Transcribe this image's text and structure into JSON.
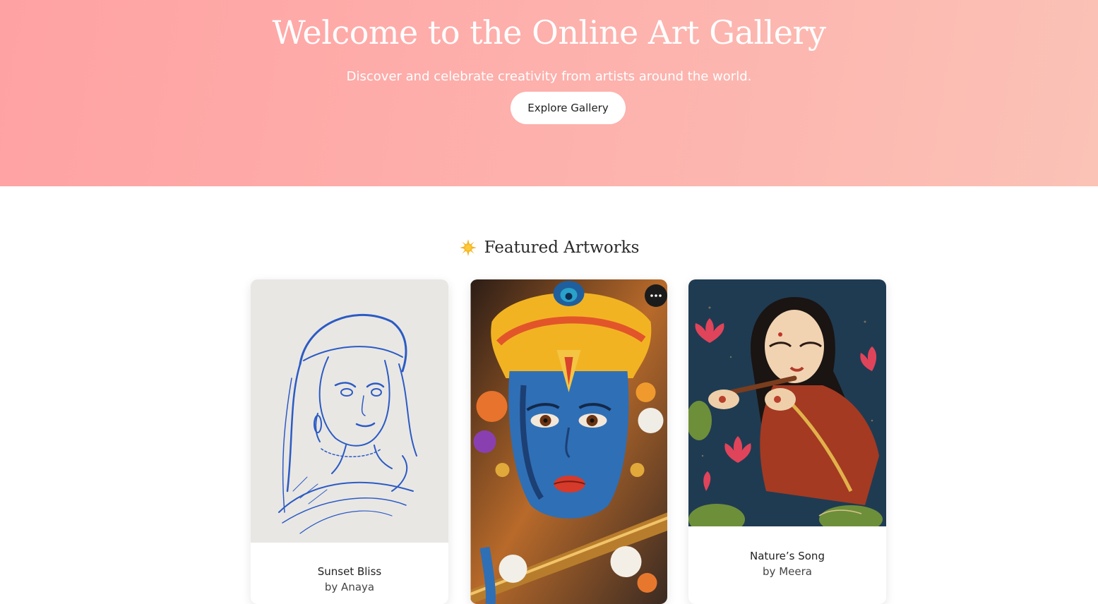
{
  "hero": {
    "title": "Welcome to the Online Art Gallery",
    "subtitle": "Discover and celebrate creativity from artists around the world.",
    "button_label": "Explore Gallery",
    "background_colors": [
      "#ffa2a3",
      "#fbc2b6"
    ]
  },
  "featured": {
    "icon": "sparkle-sun-icon",
    "title": "Featured Artworks",
    "cards": [
      {
        "title": "Sunset Bliss",
        "artist": "by Anaya",
        "image": "blue-pencil-sketch-of-girl"
      },
      {
        "title": "",
        "artist": "",
        "image": "painting-of-blue-faced-flute-player",
        "menu_icon": "more-horizontal-icon"
      },
      {
        "title": "Nature’s Song",
        "artist": "by Meera",
        "image": "painting-of-woman-playing-flute-with-lotuses"
      }
    ]
  }
}
